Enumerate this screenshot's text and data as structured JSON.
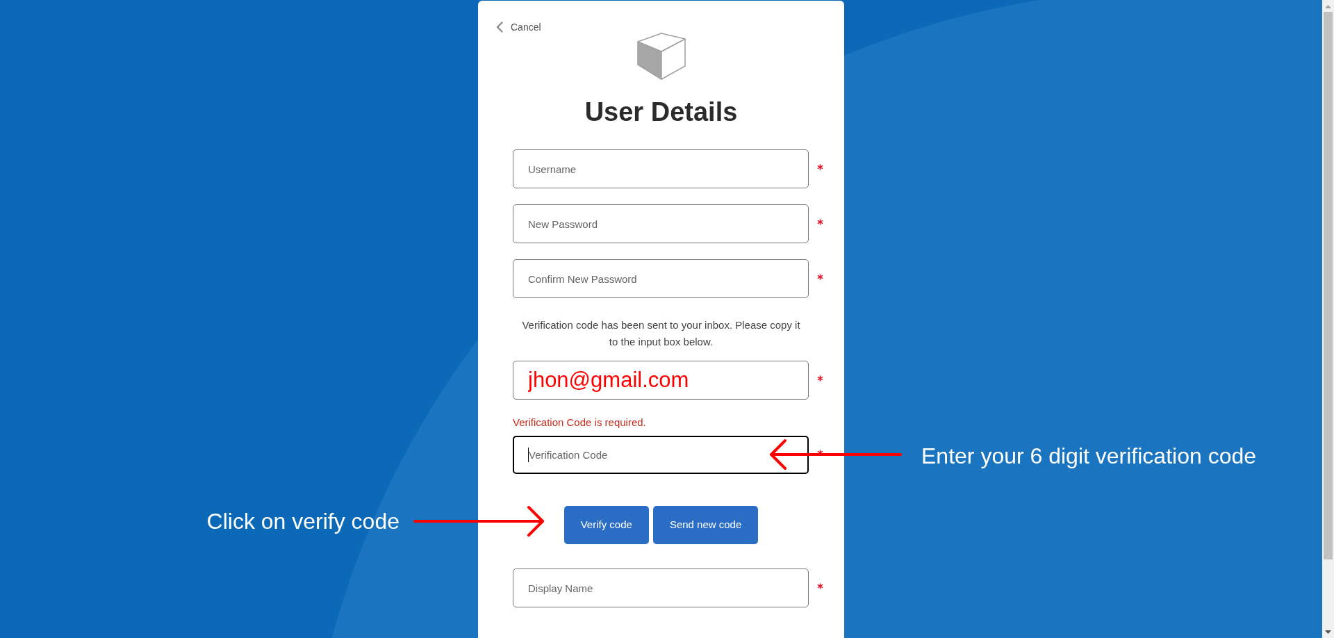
{
  "cancel": {
    "label": "Cancel"
  },
  "title": "User Details",
  "form": [
    {
      "kind": "field",
      "placeholder": "Username",
      "required": true,
      "focused": false
    },
    {
      "kind": "field",
      "placeholder": "New Password",
      "required": true,
      "focused": false
    },
    {
      "kind": "field",
      "placeholder": "Confirm New Password",
      "required": true,
      "focused": false
    },
    {
      "kind": "note",
      "text": "Verification code has been sent to your inbox. Please copy it to the input box below."
    },
    {
      "kind": "field",
      "value": "jhon@gmail.com",
      "required": true,
      "focused": false
    },
    {
      "kind": "field",
      "placeholder": "Verification Code",
      "required": true,
      "focused": true,
      "error": "Verification Code is required.",
      "annotation": {
        "kind": "leftward",
        "text": "Enter your 6 digit verification code"
      }
    },
    {
      "kind": "buttons",
      "buttons": [
        {
          "label": "Verify code"
        },
        {
          "label": "Send new code"
        }
      ],
      "annotation": {
        "kind": "rightward",
        "text": "Click on verify code"
      }
    },
    {
      "kind": "field",
      "placeholder": "Display Name",
      "required": true,
      "focused": false
    }
  ]
}
